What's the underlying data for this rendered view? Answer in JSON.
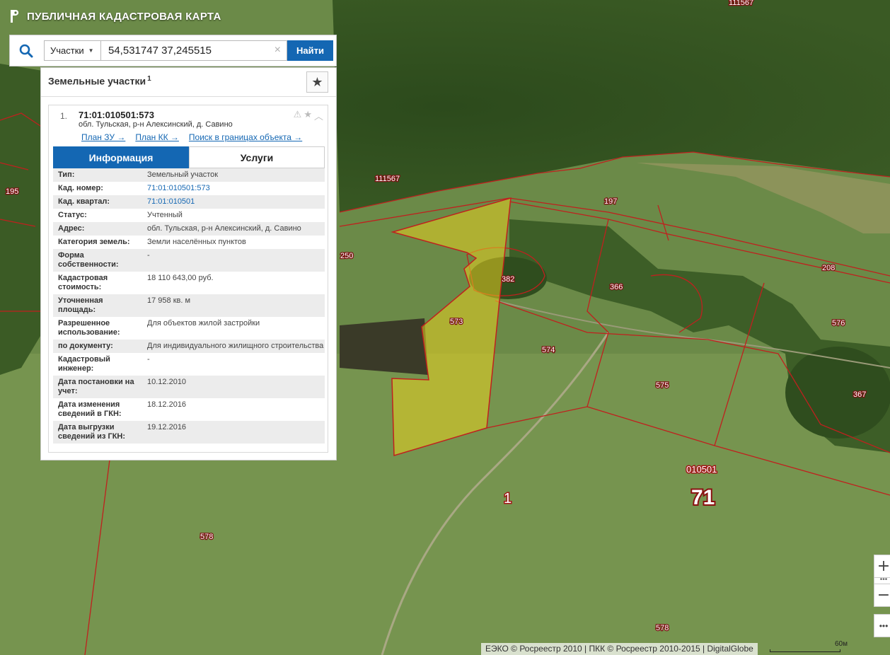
{
  "app": {
    "title": "ПУБЛИЧНАЯ КАДАСТРОВАЯ КАРТА"
  },
  "search": {
    "type_label": "Участки",
    "query": "54,531747 37,245515",
    "button_label": "Найти"
  },
  "panel": {
    "title": "Земельные участки",
    "count": "1"
  },
  "result": {
    "index": "1.",
    "number": "71:01:010501:573",
    "address": "обл. Тульская, р-н Алексинский, д. Савино",
    "links": {
      "plan_zu": "План ЗУ →",
      "plan_kk": "План КК →",
      "search_bounds": "Поиск в границах объекта →"
    },
    "tabs": {
      "info": "Информация",
      "services": "Услуги"
    },
    "rows": [
      {
        "key": "Тип:",
        "value": "Земельный участок"
      },
      {
        "key": "Кад. номер:",
        "value": "71:01:010501:573"
      },
      {
        "key": "Кад. квартал:",
        "value": "71:01:010501"
      },
      {
        "key": "Статус:",
        "value": "Учтенный"
      },
      {
        "key": "Адрес:",
        "value": "обл. Тульская, р-н Алексинский, д. Савино"
      },
      {
        "key": "Категория земель:",
        "value": "Земли населённых пунктов"
      },
      {
        "key": "Форма собственности:",
        "value": "-"
      },
      {
        "key": "Кадастровая стоимость:",
        "value": "18 110 643,00 руб."
      },
      {
        "key": "Уточненная площадь:",
        "value": "17 958 кв. м"
      },
      {
        "key": "Разрешенное использование:",
        "value": "Для объектов жилой застройки"
      },
      {
        "key": "по документу:",
        "value": "Для индивидуального жилищного строительства"
      },
      {
        "key": "Кадастровый инженер:",
        "value": "-"
      },
      {
        "key": "Дата постановки на учет:",
        "value": "10.12.2010"
      },
      {
        "key": "Дата изменения сведений в ГКН:",
        "value": "18.12.2016"
      },
      {
        "key": "Дата выгрузки сведений из ГКН:",
        "value": "19.12.2016"
      }
    ]
  },
  "map": {
    "parcel_labels": [
      "111567",
      "111567",
      "195",
      "197",
      "250",
      "382",
      "366",
      "208",
      "573",
      "574",
      "576",
      "575",
      "367",
      "578",
      "578"
    ],
    "quarter_label": "010501",
    "region_label": "71",
    "district_label": "1",
    "zoom_in": "+",
    "zoom_out": "−",
    "more": "•••",
    "attribution": "ЕЭКО © Росреестр 2010 | ПКК © Росреестр 2010-2015 | DigitalGlobe",
    "scale_label": "60м"
  },
  "colors": {
    "accent": "#1467b3",
    "parcel_border": "#c0201e",
    "selected_fill": "#e8d020"
  }
}
